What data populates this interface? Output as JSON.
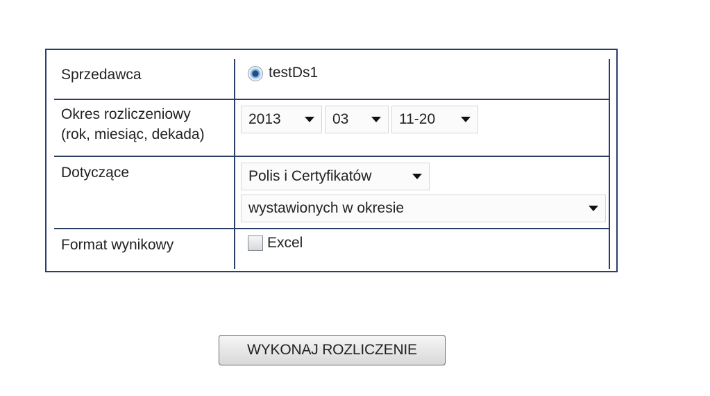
{
  "form": {
    "seller": {
      "label": "Sprzedawca",
      "option_label": "testDs1",
      "selected": true
    },
    "period": {
      "label_line1": "Okres rozliczeniowy",
      "label_line2": "(rok, miesiąc, dekada)",
      "year": "2013",
      "month": "03",
      "decade": "11-20"
    },
    "concerning": {
      "label": "Dotyczące",
      "type": "Polis i Certyfikatów",
      "scope": "wystawionych w okresie"
    },
    "output_format": {
      "label": "Format wynikowy",
      "option_label": "Excel",
      "checked": false
    }
  },
  "actions": {
    "submit_label": "WYKONAJ ROZLICZENIE"
  },
  "colors": {
    "frame_border": "#2c3d66",
    "radio_fill": "#1f4e86"
  },
  "icons": {
    "dropdown": "chevron-down-icon",
    "radio": "radio-selected-icon",
    "checkbox": "checkbox-unchecked-icon"
  }
}
